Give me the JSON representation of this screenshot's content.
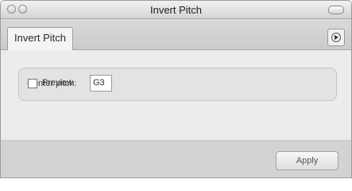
{
  "window": {
    "title": "Invert Pitch",
    "controls": [
      "close-button",
      "minimize-button",
      "toolbar-toggle"
    ]
  },
  "tabs": {
    "active_label": "Invert Pitch",
    "extra_icon": "play-circle-icon"
  },
  "settings": {
    "center_pitch_label": "Center pitch:",
    "center_pitch_value": "G3"
  },
  "preview": {
    "label": "Preview",
    "checked": false
  },
  "footer": {
    "apply_label": "Apply"
  }
}
